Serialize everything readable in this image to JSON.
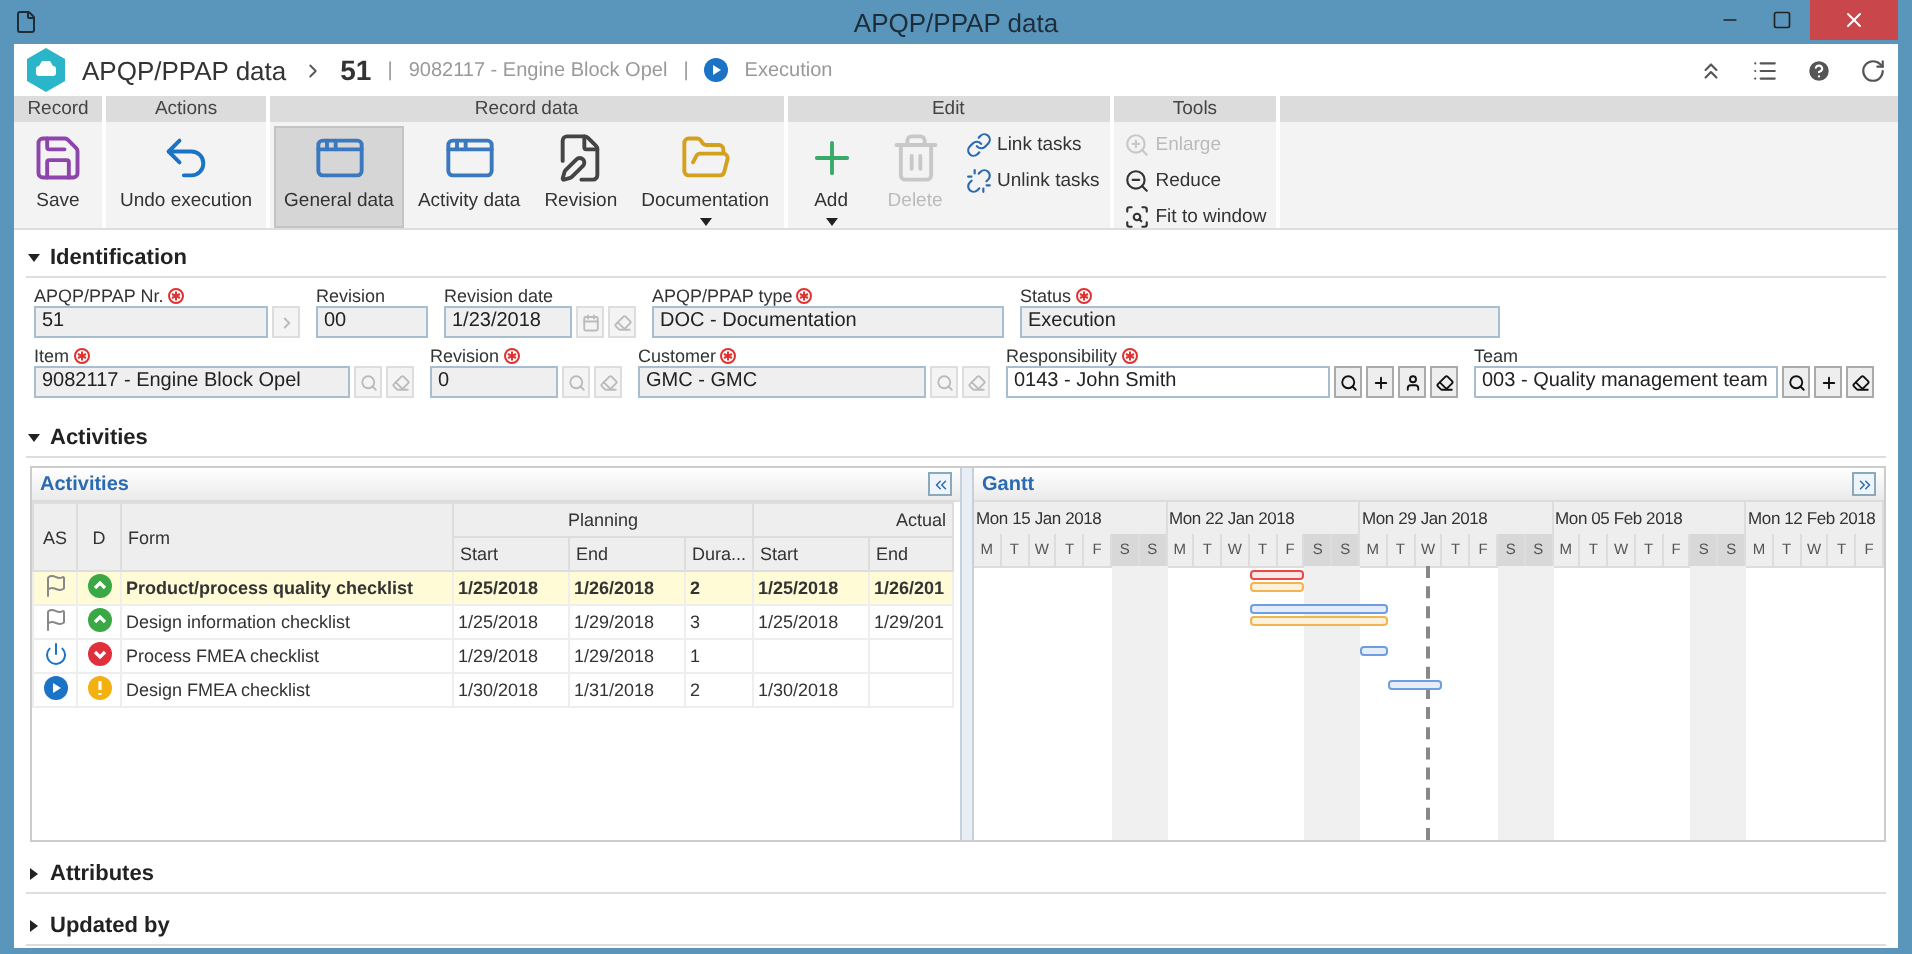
{
  "window": {
    "title": "APQP/PPAP data"
  },
  "header": {
    "module": "APQP/PPAP data",
    "record": "51",
    "item": "9082117 - Engine Block Opel",
    "status": "Execution",
    "separators": [
      "|",
      "|"
    ]
  },
  "ribbon": [
    {
      "label": "Record",
      "buttons": [
        {
          "label": "Save",
          "kind": "large",
          "selected": false,
          "disabled": false,
          "dropdown": false
        }
      ]
    },
    {
      "label": "Actions",
      "buttons": [
        {
          "label": "Undo execution",
          "kind": "large",
          "selected": false,
          "disabled": false,
          "dropdown": false
        }
      ]
    },
    {
      "label": "Record data",
      "buttons": [
        {
          "label": "General data",
          "kind": "large",
          "selected": true,
          "disabled": false,
          "dropdown": false
        },
        {
          "label": "Activity data",
          "kind": "large",
          "selected": false,
          "disabled": false,
          "dropdown": false
        },
        {
          "label": "Revision",
          "kind": "large",
          "selected": false,
          "disabled": false,
          "dropdown": false
        },
        {
          "label": "Documentation",
          "kind": "large",
          "selected": false,
          "disabled": false,
          "dropdown": true
        }
      ]
    },
    {
      "label": "Edit",
      "buttons": [
        {
          "label": "Add",
          "kind": "large",
          "selected": false,
          "disabled": false,
          "dropdown": true
        },
        {
          "label": "Delete",
          "kind": "large",
          "selected": false,
          "disabled": true,
          "dropdown": false
        },
        {
          "label": "Link tasks",
          "kind": "small",
          "selected": false,
          "disabled": false,
          "dropdown": false
        },
        {
          "label": "Unlink tasks",
          "kind": "small",
          "selected": false,
          "disabled": false,
          "dropdown": false
        }
      ]
    },
    {
      "label": "Tools",
      "buttons": [
        {
          "label": "Enlarge",
          "kind": "small",
          "selected": false,
          "disabled": true,
          "dropdown": false
        },
        {
          "label": "Reduce",
          "kind": "small",
          "selected": false,
          "disabled": false,
          "dropdown": false
        },
        {
          "label": "Fit to window",
          "kind": "small",
          "selected": false,
          "disabled": false,
          "dropdown": false
        }
      ]
    }
  ],
  "identification": {
    "title": "Identification",
    "expanded": true,
    "fields": [
      {
        "label": "APQP/PPAP Nr.",
        "required": true,
        "value": "51",
        "readonly": true,
        "buttons": [
          {
            "kind": "next",
            "disabled": true
          }
        ]
      },
      {
        "label": "Revision",
        "required": false,
        "value": "00",
        "readonly": true
      },
      {
        "label": "Revision date",
        "required": false,
        "value": "1/23/2018",
        "readonly": true,
        "buttons": [
          {
            "kind": "calendar",
            "disabled": true
          },
          {
            "kind": "clear",
            "disabled": true
          }
        ]
      },
      {
        "label": "APQP/PPAP type",
        "required": true,
        "value": "DOC - Documentation",
        "readonly": true
      },
      {
        "label": "Status",
        "required": true,
        "value": "Execution",
        "readonly": true
      },
      {
        "label": "Item",
        "required": true,
        "value": "9082117 - Engine Block Opel",
        "readonly": true,
        "buttons": [
          {
            "kind": "search",
            "disabled": true
          },
          {
            "kind": "clear",
            "disabled": true
          }
        ]
      },
      {
        "label": "Revision",
        "required": true,
        "value": "0",
        "readonly": true,
        "buttons": [
          {
            "kind": "search",
            "disabled": true
          },
          {
            "kind": "clear",
            "disabled": true
          }
        ]
      },
      {
        "label": "Customer",
        "required": true,
        "value": "GMC - GMC",
        "readonly": true,
        "buttons": [
          {
            "kind": "search",
            "disabled": true
          },
          {
            "kind": "clear",
            "disabled": true
          }
        ]
      },
      {
        "label": "Responsibility",
        "required": true,
        "value": "0143 - John Smith",
        "readonly": false,
        "buttons": [
          {
            "kind": "search",
            "disabled": false
          },
          {
            "kind": "add",
            "disabled": false
          },
          {
            "kind": "user",
            "disabled": false
          },
          {
            "kind": "clear",
            "disabled": false
          }
        ]
      },
      {
        "label": "Team",
        "required": false,
        "value": "003 - Quality management team",
        "readonly": false,
        "buttons": [
          {
            "kind": "search",
            "disabled": false
          },
          {
            "kind": "add",
            "disabled": false
          },
          {
            "kind": "clear",
            "disabled": false
          }
        ]
      }
    ]
  },
  "activities": {
    "title": "Activities",
    "expanded": true,
    "table": {
      "title": "Activities",
      "columns": [
        "AS",
        "D",
        "Form"
      ],
      "groups": [
        {
          "label": "Planning",
          "columns": [
            "Start",
            "End",
            "Dura..."
          ]
        },
        {
          "label": "Actual",
          "columns": [
            "Start",
            "End"
          ]
        }
      ],
      "rows": [
        {
          "status": {
            "kind": "finished"
          },
          "deadline": {
            "kind": "on_time"
          },
          "form": "Product/process quality checklist",
          "plan_start": "1/25/2018",
          "plan_end": "1/26/2018",
          "duration": "2",
          "actual_start": "1/25/2018",
          "actual_end": "1/26/201",
          "selected": true
        },
        {
          "status": {
            "kind": "finished"
          },
          "deadline": {
            "kind": "on_time"
          },
          "form": "Design information checklist",
          "plan_start": "1/25/2018",
          "plan_end": "1/29/2018",
          "duration": "3",
          "actual_start": "1/25/2018",
          "actual_end": "1/29/201",
          "selected": false
        },
        {
          "status": {
            "kind": "suspended"
          },
          "deadline": {
            "kind": "late"
          },
          "form": "Process FMEA checklist",
          "plan_start": "1/29/2018",
          "plan_end": "1/29/2018",
          "duration": "1",
          "selected": false
        },
        {
          "status": {
            "kind": "running"
          },
          "deadline": {
            "kind": "due"
          },
          "form": "Design FMEA checklist",
          "plan_start": "1/30/2018",
          "plan_end": "1/31/2018",
          "duration": "2",
          "actual_start": "1/30/2018",
          "selected": false
        }
      ]
    },
    "gantt": {
      "title": "Gantt",
      "bars": [
        {
          "late": true
        },
        {
          "late": false
        },
        {
          "late": false
        },
        {
          "late": false
        }
      ],
      "weeks": [
        {
          "label": "Mon 15 Jan 2018",
          "days": [
            {
              "label": "M",
              "today": false
            },
            {
              "label": "T",
              "today": false
            },
            {
              "label": "W",
              "today": false
            },
            {
              "label": "T",
              "today": false
            },
            {
              "label": "F",
              "today": false
            },
            {
              "label": "S",
              "today": false
            },
            {
              "label": "S",
              "today": false
            }
          ]
        },
        {
          "label": "Mon 22 Jan 2018",
          "days": [
            {
              "label": "M",
              "today": false
            },
            {
              "label": "T",
              "today": false
            },
            {
              "label": "W",
              "today": false
            },
            {
              "label": "T",
              "today": false
            },
            {
              "label": "F",
              "today": false
            },
            {
              "label": "S",
              "today": false
            },
            {
              "label": "S",
              "today": false
            }
          ]
        },
        {
          "label": "Mon 29 Jan 2018",
          "days": [
            {
              "label": "M",
              "today": false
            },
            {
              "label": "T",
              "today": false
            },
            {
              "label": "W",
              "today": true
            },
            {
              "label": "T",
              "today": false
            },
            {
              "label": "F",
              "today": false
            },
            {
              "label": "S",
              "today": false
            },
            {
              "label": "S",
              "today": false
            }
          ]
        },
        {
          "label": "Mon 05 Feb 2018",
          "days": [
            {
              "label": "M",
              "today": false
            },
            {
              "label": "T",
              "today": false
            },
            {
              "label": "W",
              "today": false
            },
            {
              "label": "T",
              "today": false
            },
            {
              "label": "F",
              "today": false
            },
            {
              "label": "S",
              "today": false
            },
            {
              "label": "S",
              "today": false
            }
          ]
        },
        {
          "label": "Mon 12 Feb 2018",
          "days": [
            {
              "label": "M",
              "today": false
            },
            {
              "label": "T",
              "today": false
            },
            {
              "label": "W",
              "today": false
            },
            {
              "label": "T",
              "today": false
            },
            {
              "label": "F",
              "today": false
            }
          ]
        }
      ]
    }
  },
  "collapsed_sections": [
    {
      "title": "Attributes",
      "expanded": false
    },
    {
      "title": "Updated by",
      "expanded": false
    }
  ]
}
